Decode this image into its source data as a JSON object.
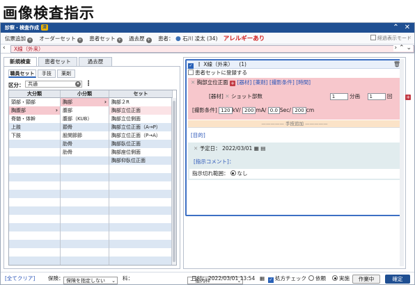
{
  "page_title": "画像検査指示",
  "window": {
    "title": "診察・検査作成",
    "title_badge": "済",
    "toolbar": {
      "items": [
        "伝票追加",
        "オーダーセット",
        "患者セット",
        "過去歴"
      ],
      "patient_label": "患者：",
      "patient_name": "石川 凌太 (34)",
      "allergy": "アレルギーあり",
      "right_check": "経過表示モード"
    },
    "order_tab": "X線（外来）",
    "left": {
      "tabs": [
        "新規検査",
        "患者セット",
        "過去歴"
      ],
      "subtabs": [
        "職員セット",
        "手技",
        "薬剤"
      ],
      "kubun_label": "区分：",
      "kubun_value": "共通",
      "headers": [
        "大分類",
        "小分類",
        "セット"
      ],
      "col1": [
        "頭部・頸部",
        "胸腹部",
        "脊髄・体幹",
        "上肢",
        "下肢"
      ],
      "col2": [
        "胸部",
        "腹部",
        "腹部（KUB）",
        "頚骨",
        "股関節節",
        "肋骨",
        "肋骨"
      ],
      "col3": [
        "胸部２R",
        "胸部立位正面",
        "胸部立位側面",
        "胸部立位正面（A→P）",
        "胸部立位正面（P→A）",
        "胸部臥位正面",
        "胸部座位側面",
        "胸部仰臥位正面"
      ]
    },
    "right": {
      "card_title": "X線（外来）",
      "card_count": "(1)",
      "register_label": "患者セットに登録する",
      "procedure": "胸部立位正面",
      "links": [
        "[器材]",
        "[薬剤]",
        "[撮影条件]",
        "[時間]"
      ],
      "equipment_label": "[器材]",
      "equipment_name": "ショット部数",
      "equipment_qty": "1",
      "equipment_unit": "分画",
      "equipment_qty2": "1",
      "equipment_unit2": "回",
      "cond_label": "[撮影条件]",
      "cond_vals": [
        "120",
        "200",
        "0.0",
        "200"
      ],
      "cond_units": [
        "kV/",
        "mA/",
        "Sec/",
        "cm"
      ],
      "add_link": "手技追加",
      "purpose_label": "[目的]",
      "date_label": "予定日：",
      "date_value": "2022/03/01",
      "comment_label": "[指示コメント]：",
      "switch_label": "指示切れ範囲：",
      "switch_value": "なし"
    },
    "bottom": {
      "clear_link": "[全てクリア]",
      "insurance_label": "保険：",
      "insurance_value": "保険を指定しない",
      "dept_label": "科：",
      "dept_value": "一般内科",
      "datetime_label": "日付：",
      "datetime_value": "2022/03/01 13:54",
      "rx_check": "処方チェック",
      "radio1": "依頼",
      "radio2": "実施",
      "working_btn": "作業中",
      "confirm_btn": "確定"
    }
  }
}
